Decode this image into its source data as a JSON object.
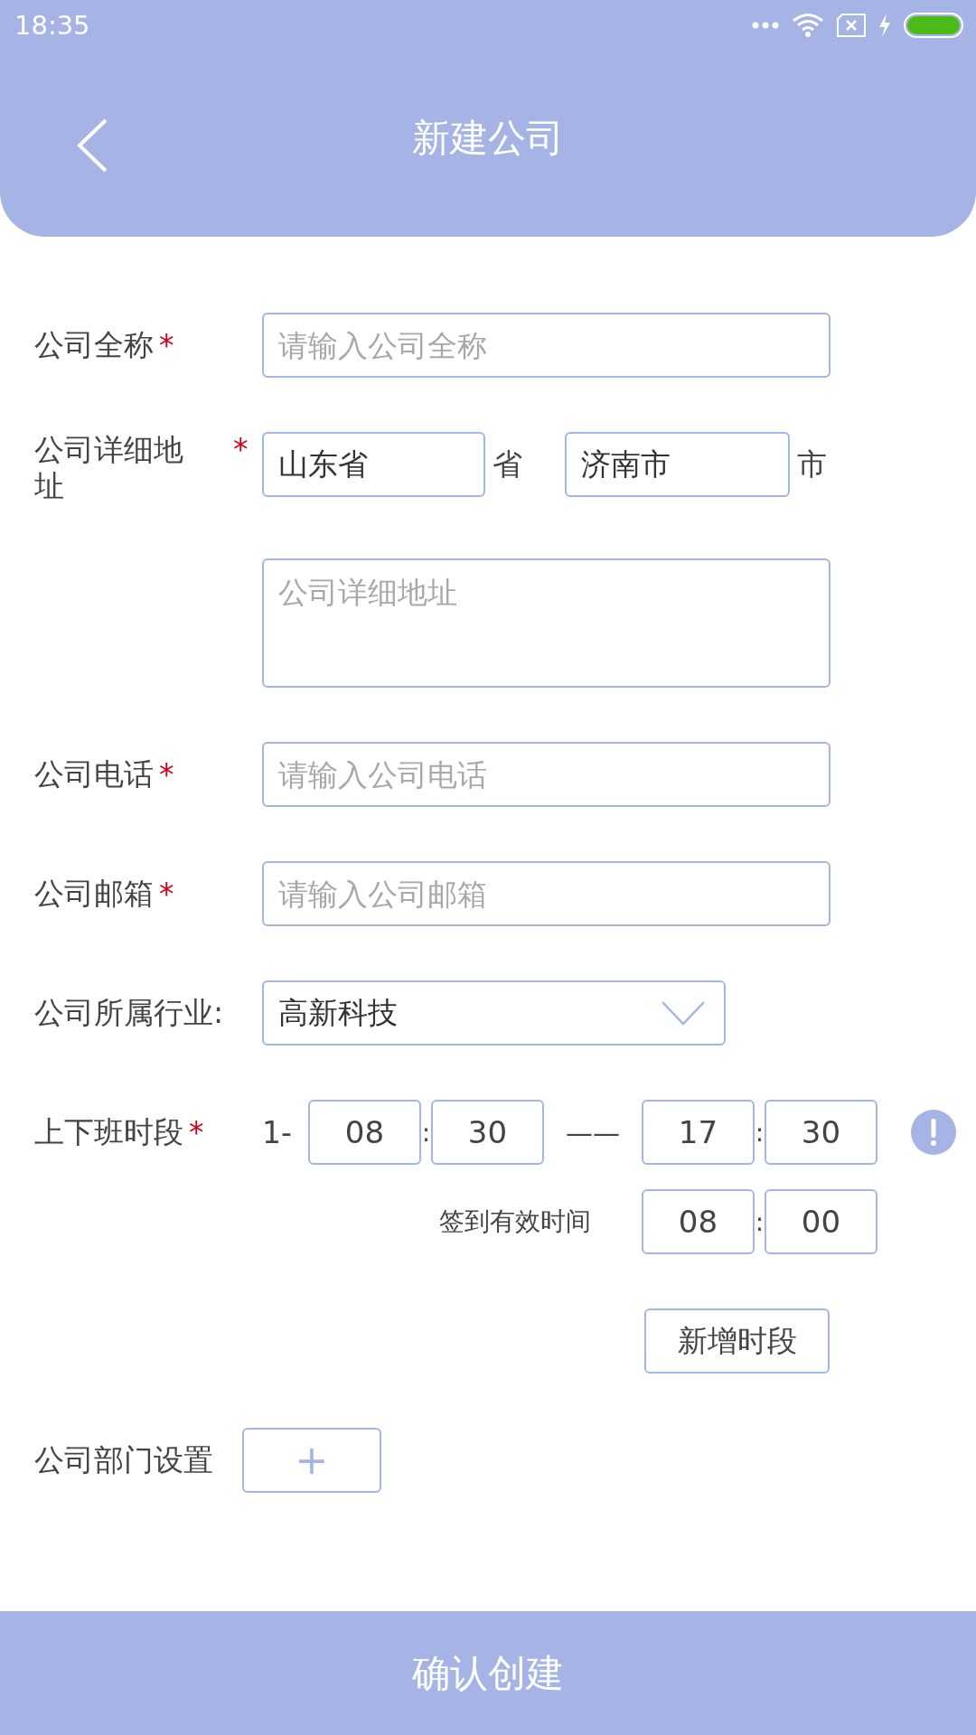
{
  "status_bar": {
    "time": "18:35"
  },
  "header": {
    "title": "新建公司"
  },
  "form": {
    "company_name": {
      "label": "公司全称",
      "required_mark": "*",
      "placeholder": "请输入公司全称"
    },
    "address": {
      "label": "公司详细地址",
      "required_mark": "*",
      "province": "山东省",
      "province_suffix": "省",
      "city": "济南市",
      "city_suffix": "市",
      "detail_placeholder": "公司详细地址"
    },
    "phone": {
      "label": "公司电话",
      "required_mark": "*",
      "placeholder": "请输入公司电话"
    },
    "email": {
      "label": "公司邮箱",
      "required_mark": "*",
      "placeholder": "请输入公司邮箱"
    },
    "industry": {
      "label": "公司所属行业:",
      "value": "高新科技"
    },
    "work_hours": {
      "label": "上下班时段",
      "required_mark": "*",
      "period_label": "1-",
      "start": {
        "hour": "08",
        "colon": ":",
        "minute": "30"
      },
      "separator": "——",
      "end": {
        "hour": "17",
        "colon": ":",
        "minute": "30"
      },
      "sign_in_label": "签到有效时间",
      "sign_in": {
        "hour": "08",
        "colon": ":",
        "minute": "00"
      }
    },
    "add_period_button": "新增时段",
    "departments": {
      "label": "公司部门设置",
      "add_button": "+"
    }
  },
  "submit_button": "确认创建"
}
